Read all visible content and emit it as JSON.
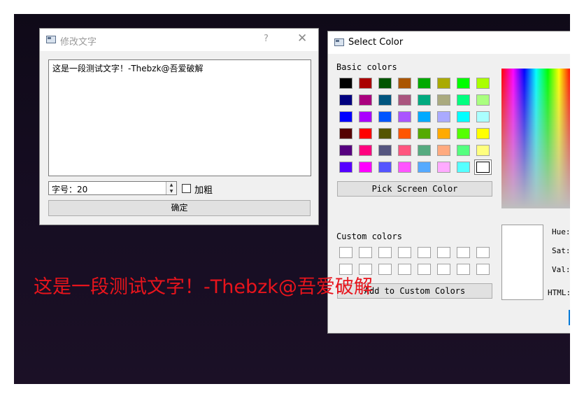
{
  "edit_dialog": {
    "title": "修改文字",
    "help_glyph": "?",
    "close_glyph": "✕",
    "text_content": "这是一段测试文字！-Thebzk@吾爱破解",
    "font_size_value": "字号：20",
    "bold_label": "加粗",
    "bold_checked": false,
    "ok_label": "确定"
  },
  "color_dialog": {
    "title": "Select Color",
    "basic_colors_label": "Basic colors",
    "basic_colors": [
      [
        "#000000",
        "#aa0000",
        "#005500",
        "#aa5500",
        "#00aa00",
        "#aaaa00",
        "#00ff00",
        "#aaff00"
      ],
      [
        "#00007f",
        "#aa007f",
        "#00557f",
        "#aa557f",
        "#00aa7f",
        "#aaaa7f",
        "#00ff7f",
        "#aaff7f"
      ],
      [
        "#0000ff",
        "#aa00ff",
        "#0055ff",
        "#aa55ff",
        "#00aaff",
        "#aaaaff",
        "#00ffff",
        "#aaffff"
      ],
      [
        "#550000",
        "#ff0000",
        "#555500",
        "#ff5500",
        "#55aa00",
        "#ffaa00",
        "#55ff00",
        "#ffff00"
      ],
      [
        "#55007f",
        "#ff007f",
        "#55557f",
        "#ff557f",
        "#55aa7f",
        "#ffaa7f",
        "#55ff7f",
        "#ffff7f"
      ],
      [
        "#5500ff",
        "#ff00ff",
        "#5555ff",
        "#ff55ff",
        "#55aaff",
        "#ffaaff",
        "#55ffff",
        "#ffffff"
      ]
    ],
    "selected_basic_color": "#ffffff",
    "pick_screen_label": "Pick Screen Color",
    "custom_colors_label": "Custom colors",
    "add_custom_label": "Add to Custom Colors",
    "hue_label": "Hue:",
    "sat_label": "Sat:",
    "val_label": "Val:",
    "html_label": "HTML:"
  },
  "overlay_text": "这是一段测试文字！-Thebzk@吾爱破解",
  "overlay_color": "#e8141c"
}
